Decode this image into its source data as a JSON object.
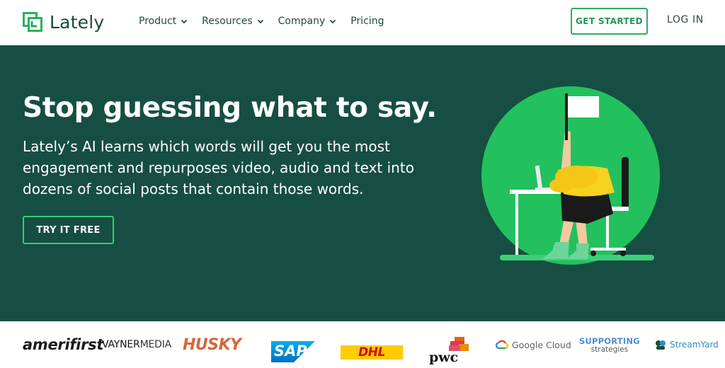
{
  "header": {
    "logo_text": "Lately",
    "nav": [
      {
        "label": "Product",
        "has_dropdown": true
      },
      {
        "label": "Resources",
        "has_dropdown": true
      },
      {
        "label": "Company",
        "has_dropdown": true
      },
      {
        "label": "Pricing",
        "has_dropdown": false
      }
    ],
    "get_started_label": "GET STARTED",
    "login_label": "LOG IN"
  },
  "hero": {
    "title": "Stop guessing what to say.",
    "subtitle": "Lately’s AI learns which words will get you the most engagement and repurposes video, audio and text into dozens of social posts that contain those words.",
    "cta_label": "TRY IT FREE"
  },
  "logos": {
    "amerifirst": "amerifirst",
    "vayner_bold": "VAYNER",
    "vayner_thin": "MEDIA",
    "husky": "HUSKY",
    "sap": "SAP",
    "dhl": "DHL",
    "pwc": "pwc",
    "google": "Google Cloud",
    "supporting_1": "SUPPORTING",
    "supporting_2": "strategies",
    "streamyard": "StreamYard"
  },
  "colors": {
    "brand_green": "#2aaf5f",
    "hero_bg": "#174e43",
    "illustration_circle": "#22c15e",
    "text_dark": "#1d4a3f"
  }
}
